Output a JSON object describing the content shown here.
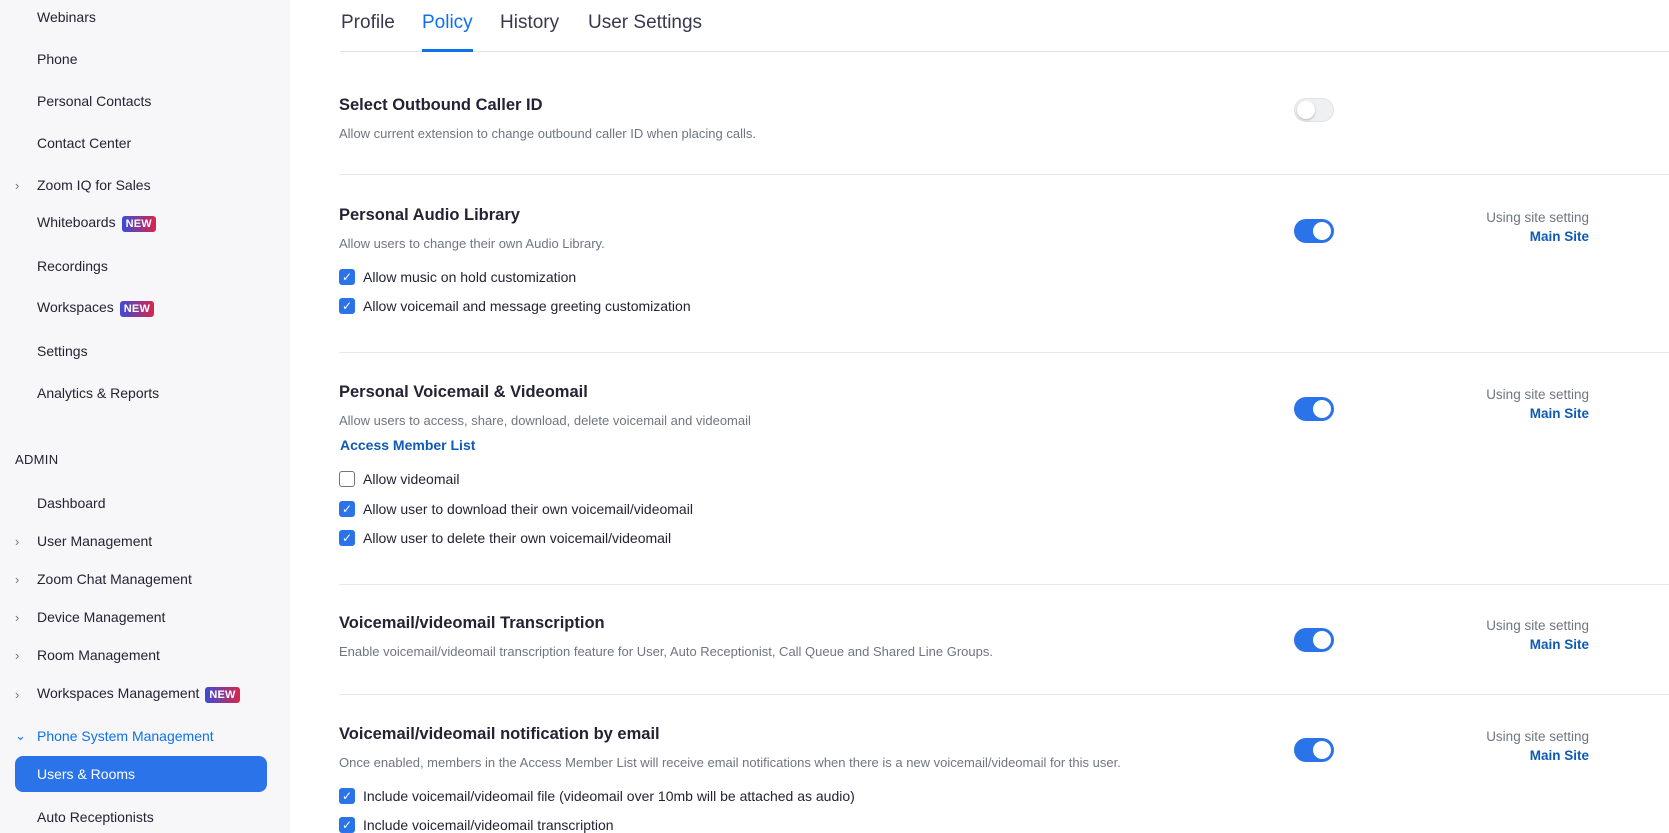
{
  "sidebar": {
    "items": [
      {
        "label": "Webinars"
      },
      {
        "label": "Phone"
      },
      {
        "label": "Personal Contacts"
      },
      {
        "label": "Contact Center"
      },
      {
        "label": "Zoom IQ for Sales"
      },
      {
        "label": "Whiteboards",
        "badge": "NEW"
      },
      {
        "label": "Recordings"
      },
      {
        "label": "Workspaces",
        "badge": "NEW"
      },
      {
        "label": "Settings"
      },
      {
        "label": "Analytics & Reports"
      }
    ],
    "admin_heading": "ADMIN",
    "admin_items": [
      {
        "label": "Dashboard"
      },
      {
        "label": "User Management"
      },
      {
        "label": "Zoom Chat Management"
      },
      {
        "label": "Device Management"
      },
      {
        "label": "Room Management"
      },
      {
        "label": "Workspaces Management",
        "badge": "NEW"
      },
      {
        "label": "Phone System Management"
      },
      {
        "label": "Users & Rooms"
      },
      {
        "label": "Auto Receptionists"
      }
    ]
  },
  "tabs": [
    {
      "label": "Profile"
    },
    {
      "label": "Policy"
    },
    {
      "label": "History"
    },
    {
      "label": "User Settings"
    }
  ],
  "active_tab": "Policy",
  "site_setting": {
    "using": "Using site setting",
    "site": "Main Site"
  },
  "settings": [
    {
      "title": "Select Outbound Caller ID",
      "desc": "Allow current extension to change outbound caller ID when placing calls.",
      "enabled": false
    },
    {
      "title": "Personal Audio Library",
      "desc": "Allow users to change their own Audio Library.",
      "enabled": true,
      "options": [
        {
          "label": "Allow music on hold customization",
          "checked": true
        },
        {
          "label": "Allow voicemail and message greeting customization",
          "checked": true
        }
      ]
    },
    {
      "title": "Personal Voicemail & Videomail",
      "desc": "Allow users to access, share, download, delete voicemail and videomail",
      "link": "Access Member List",
      "enabled": true,
      "options": [
        {
          "label": "Allow videomail",
          "checked": false
        },
        {
          "label": "Allow user to download their own voicemail/videomail",
          "checked": true
        },
        {
          "label": "Allow user to delete their own voicemail/videomail",
          "checked": true
        }
      ]
    },
    {
      "title": "Voicemail/videomail Transcription",
      "desc": "Enable voicemail/videomail transcription feature for User, Auto Receptionist, Call Queue and Shared Line Groups.",
      "enabled": true
    },
    {
      "title": "Voicemail/videomail notification by email",
      "desc": "Once enabled, members in the Access Member List will receive email notifications when there is a new voicemail/videomail for this user.",
      "enabled": true,
      "options": [
        {
          "label": "Include voicemail/videomail file (videomail over 10mb will be attached as audio)",
          "checked": true
        },
        {
          "label": "Include voicemail/videomail transcription",
          "checked": true
        }
      ]
    }
  ],
  "colors": {
    "accent": "#0e71eb",
    "toggle_on": "#2a73e8",
    "link": "#0e5bb5"
  },
  "icons": {
    "nav_expand": "chevron-right-icon",
    "nav_expanded": "chevron-down-icon",
    "checkbox": "checkmark-icon"
  }
}
